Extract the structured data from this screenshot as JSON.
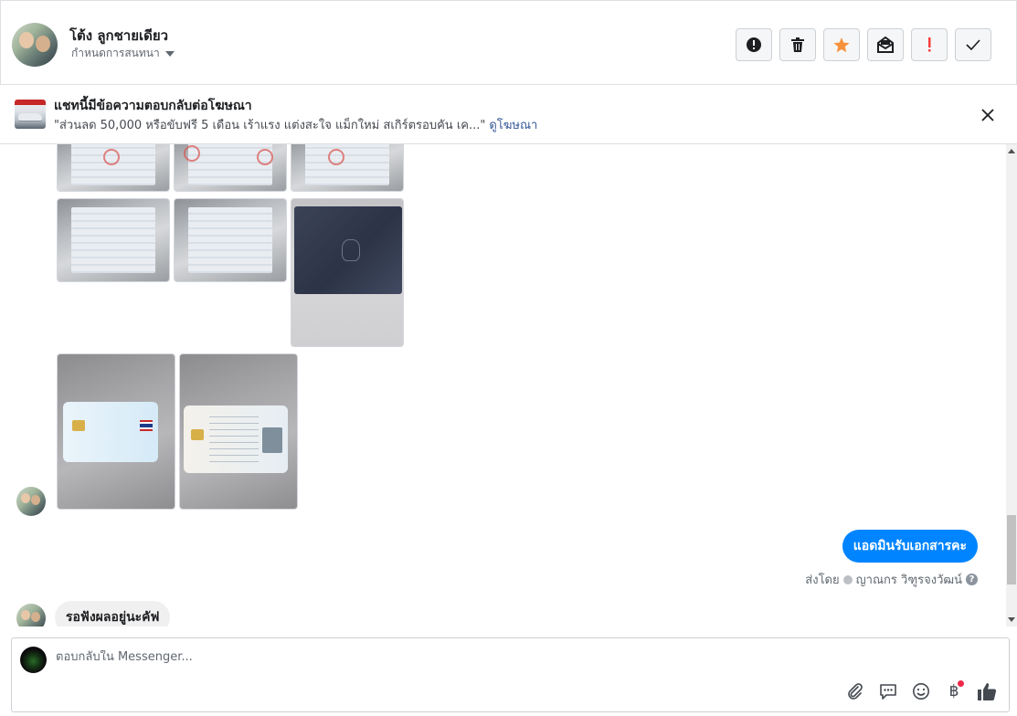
{
  "header": {
    "contact_name": "โต้ง ลูกชายเดียว",
    "conversation_label": "กำหนดการสนทนา",
    "actions": [
      {
        "name": "spam-report",
        "icon": "alert-circle-icon",
        "color": "#1c1e21"
      },
      {
        "name": "delete",
        "icon": "trash-icon",
        "color": "#1c1e21"
      },
      {
        "name": "star",
        "icon": "star-icon",
        "color": "#f7923b"
      },
      {
        "name": "mark-unread",
        "icon": "envelope-open-icon",
        "color": "#1c1e21"
      },
      {
        "name": "important",
        "icon": "exclamation-icon",
        "color": "#fa3e3e"
      },
      {
        "name": "done",
        "icon": "check-icon",
        "color": "#1c1e21"
      }
    ]
  },
  "ad_banner": {
    "title": "แชทนี้มีข้อความตอบกลับต่อโฆษณา",
    "description": "\"ส่วนลด 50,000 หรือขับฟรี 5 เดือน เร้าแรง แต่งสะใจ แม็กใหม่ สเกิร์ตรอบคัน เค...\"",
    "link": "ดูโฆษณา"
  },
  "messages": {
    "outgoing_text": "แอดมินรับเอกสารคะ",
    "sent_by_prefix": "ส่งโดย",
    "sent_by_name": "ญาณกร วิฑูรจงวัฒน์",
    "incoming_text": "รอฟังผลอยู่นะคัฟ"
  },
  "composer": {
    "placeholder": "ตอบกลับใน Messenger...",
    "baht_symbol": "฿"
  },
  "colors": {
    "accent": "#0084ff",
    "link": "#365899",
    "star": "#f7923b",
    "important": "#fa3e3e"
  }
}
